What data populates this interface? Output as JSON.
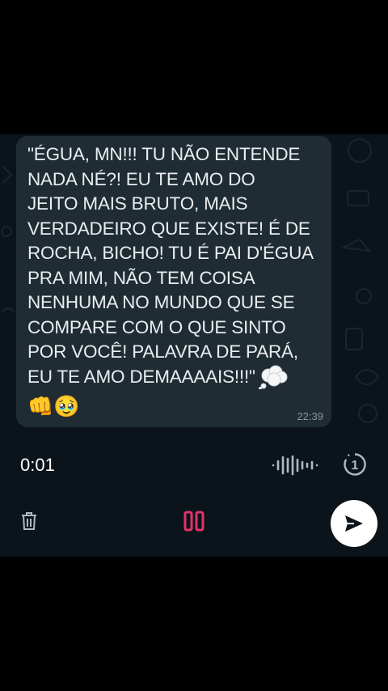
{
  "message": {
    "text": "\"ÉGUA, MN!!! TU NÃO ENTENDE\nNADA NÉ?! EU TE AMO DO\nJEITO MAIS BRUTO, MAIS\nVERDADEIRO QUE EXISTE! É DE\nROCHA, BICHO! TU É PAI D'ÉGUA\nPRA MIM, NÃO TEM COISA\nNENHUMA NO MUNDO QUE SE\nCOMPARE COM O QUE SINTO\nPOR VOCÊ! PALAVRA DE PARÁ,\nEU TE AMO DEMAAAAIS!!!\"",
    "emoji_1": "👊",
    "emoji_2": "🥹",
    "time": "22:39"
  },
  "recorder": {
    "elapsed": "0:01",
    "view_once_label": "1",
    "accent_color": "#e2336b"
  },
  "colors": {
    "background": "#000000",
    "chat_background": "#0b141a",
    "bubble": "#1f2c33",
    "text": "#e9edef",
    "timestamp": "#8696a0",
    "send_button": "#ffffff"
  },
  "icons": {
    "thought_balloon": "thought-balloon-icon",
    "waveform": "waveform-icon",
    "view_once": "view-once-icon",
    "trash": "trash-icon",
    "pause": "pause-icon",
    "send": "send-icon"
  }
}
